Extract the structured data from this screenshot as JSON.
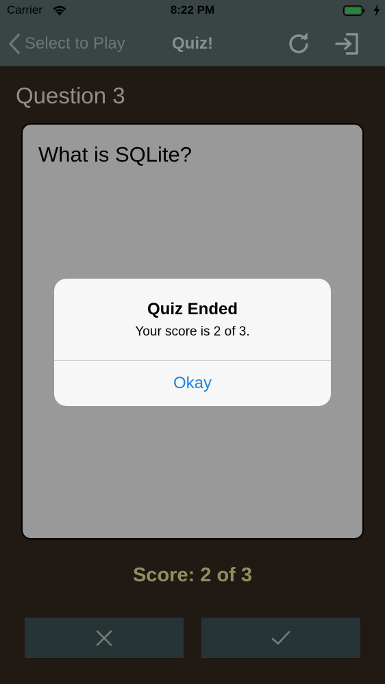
{
  "status_bar": {
    "carrier": "Carrier",
    "time": "8:22 PM",
    "icons": [
      "wifi-icon",
      "battery-icon",
      "charging-bolt-icon"
    ]
  },
  "nav": {
    "back_label": "Select to Play",
    "title": "Quiz!",
    "icons": [
      "chevron-left-icon",
      "refresh-icon",
      "exit-icon"
    ]
  },
  "question": {
    "heading": "Question 3",
    "text": "What is SQLite?"
  },
  "score": {
    "label": "Score: 2 of 3"
  },
  "answer_buttons": {
    "wrong_icon": "x-icon",
    "right_icon": "checkmark-icon"
  },
  "alert": {
    "title": "Quiz Ended",
    "message": "Your score is 2 of 3.",
    "button_label": "Okay"
  },
  "colors": {
    "nav_background": "#5f7273",
    "page_background": "#362b22",
    "score_text": "#f4ec9c",
    "alert_button": "#1b84e6",
    "answer_button_background": "#42575a"
  }
}
